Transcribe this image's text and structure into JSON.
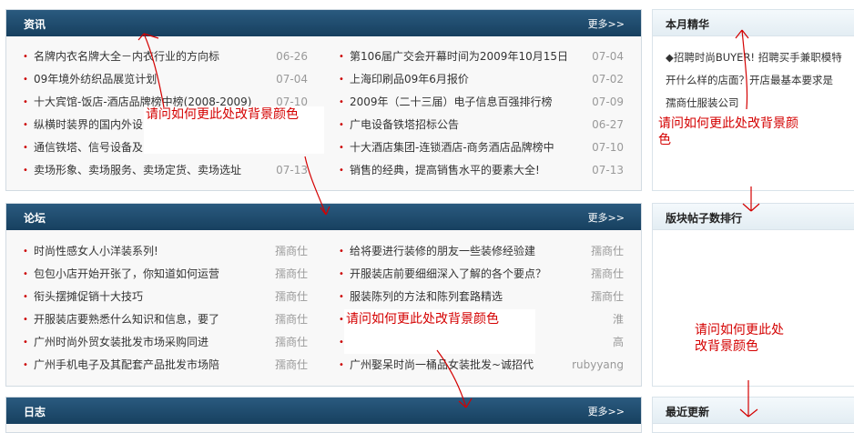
{
  "news": {
    "title": "资讯",
    "more": "更多>>",
    "left": [
      {
        "text": "名牌内衣名牌大全－内衣行业的方向标",
        "date": "06-26"
      },
      {
        "text": "09年境外纺织品展览计划",
        "date": "07-04"
      },
      {
        "text": "十大宾馆-饭店-酒店品牌榜中榜(2008-2009)",
        "date": "07-10"
      },
      {
        "text": "纵横时装界的国内外设",
        "date": ""
      },
      {
        "text": "通信铁塔、信号设备及",
        "date": ""
      },
      {
        "text": "卖场形象、卖场服务、卖场定货、卖场选址",
        "date": "07-13"
      }
    ],
    "right": [
      {
        "text": "第106届广交会开幕时间为2009年10月15日",
        "date": "07-04"
      },
      {
        "text": "上海印刷品09年6月报价",
        "date": "07-02"
      },
      {
        "text": "2009年（二十三届）电子信息百强排行榜",
        "date": "07-09"
      },
      {
        "text": "广电设备铁塔招标公告",
        "date": "06-27"
      },
      {
        "text": "十大酒店集团-连锁酒店-商务酒店品牌榜中",
        "date": "07-10"
      },
      {
        "text": "销售的经典，提高销售水平的要素大全!",
        "date": "07-13"
      }
    ]
  },
  "forum": {
    "title": "论坛",
    "more": "更多>>",
    "left": [
      {
        "text": "时尚性感女人小洋装系列!",
        "author": "孺商仕"
      },
      {
        "text": "包包小店开始开张了，你知道如何运营",
        "author": "孺商仕"
      },
      {
        "text": "衔头摆摊促销十大技巧",
        "author": "孺商仕"
      },
      {
        "text": "开服装店要熟悉什么知识和信息，要了",
        "author": "孺商仕"
      },
      {
        "text": "广州时尚外贸女装批发市场采购同进",
        "author": "孺商仕"
      },
      {
        "text": "广州手机电子及其配套产品批发市场陪",
        "author": "孺商仕"
      }
    ],
    "right": [
      {
        "text": "给将要进行装修的朋友一些装修经验建",
        "author": "孺商仕"
      },
      {
        "text": "开服装店前要细细深入了解的各个要点？",
        "author": "孺商仕"
      },
      {
        "text": "服装陈列的方法和陈列套路精选",
        "author": "孺商仕"
      },
      {
        "text": "",
        "author": "淮"
      },
      {
        "text": "",
        "author": "高"
      },
      {
        "text": "广州娶呆时尚一桶品女装批发~诚招代",
        "author": "rubyyang"
      }
    ]
  },
  "blog": {
    "title": "日志",
    "more": "更多>>"
  },
  "side": {
    "month_title": "本月精华",
    "month_text_1": "◆招聘时尚BUYER! 招聘买手兼职模特",
    "month_text_2": "开什么样的店面？开店最基本要求是",
    "month_text_3": "孺商仕服装公司",
    "rank_title": "版块帖子数排行",
    "latest_title": "最近更新"
  },
  "annotations": {
    "a1": "请问如何更此处改背景颜色",
    "a2_l1": "请问如何更此处改背景颜",
    "a2_l2": "色",
    "a3": "请问如何更此处改背景颜色",
    "a4_l1": "请问如何更此处",
    "a4_l2": "改背景颜色"
  }
}
